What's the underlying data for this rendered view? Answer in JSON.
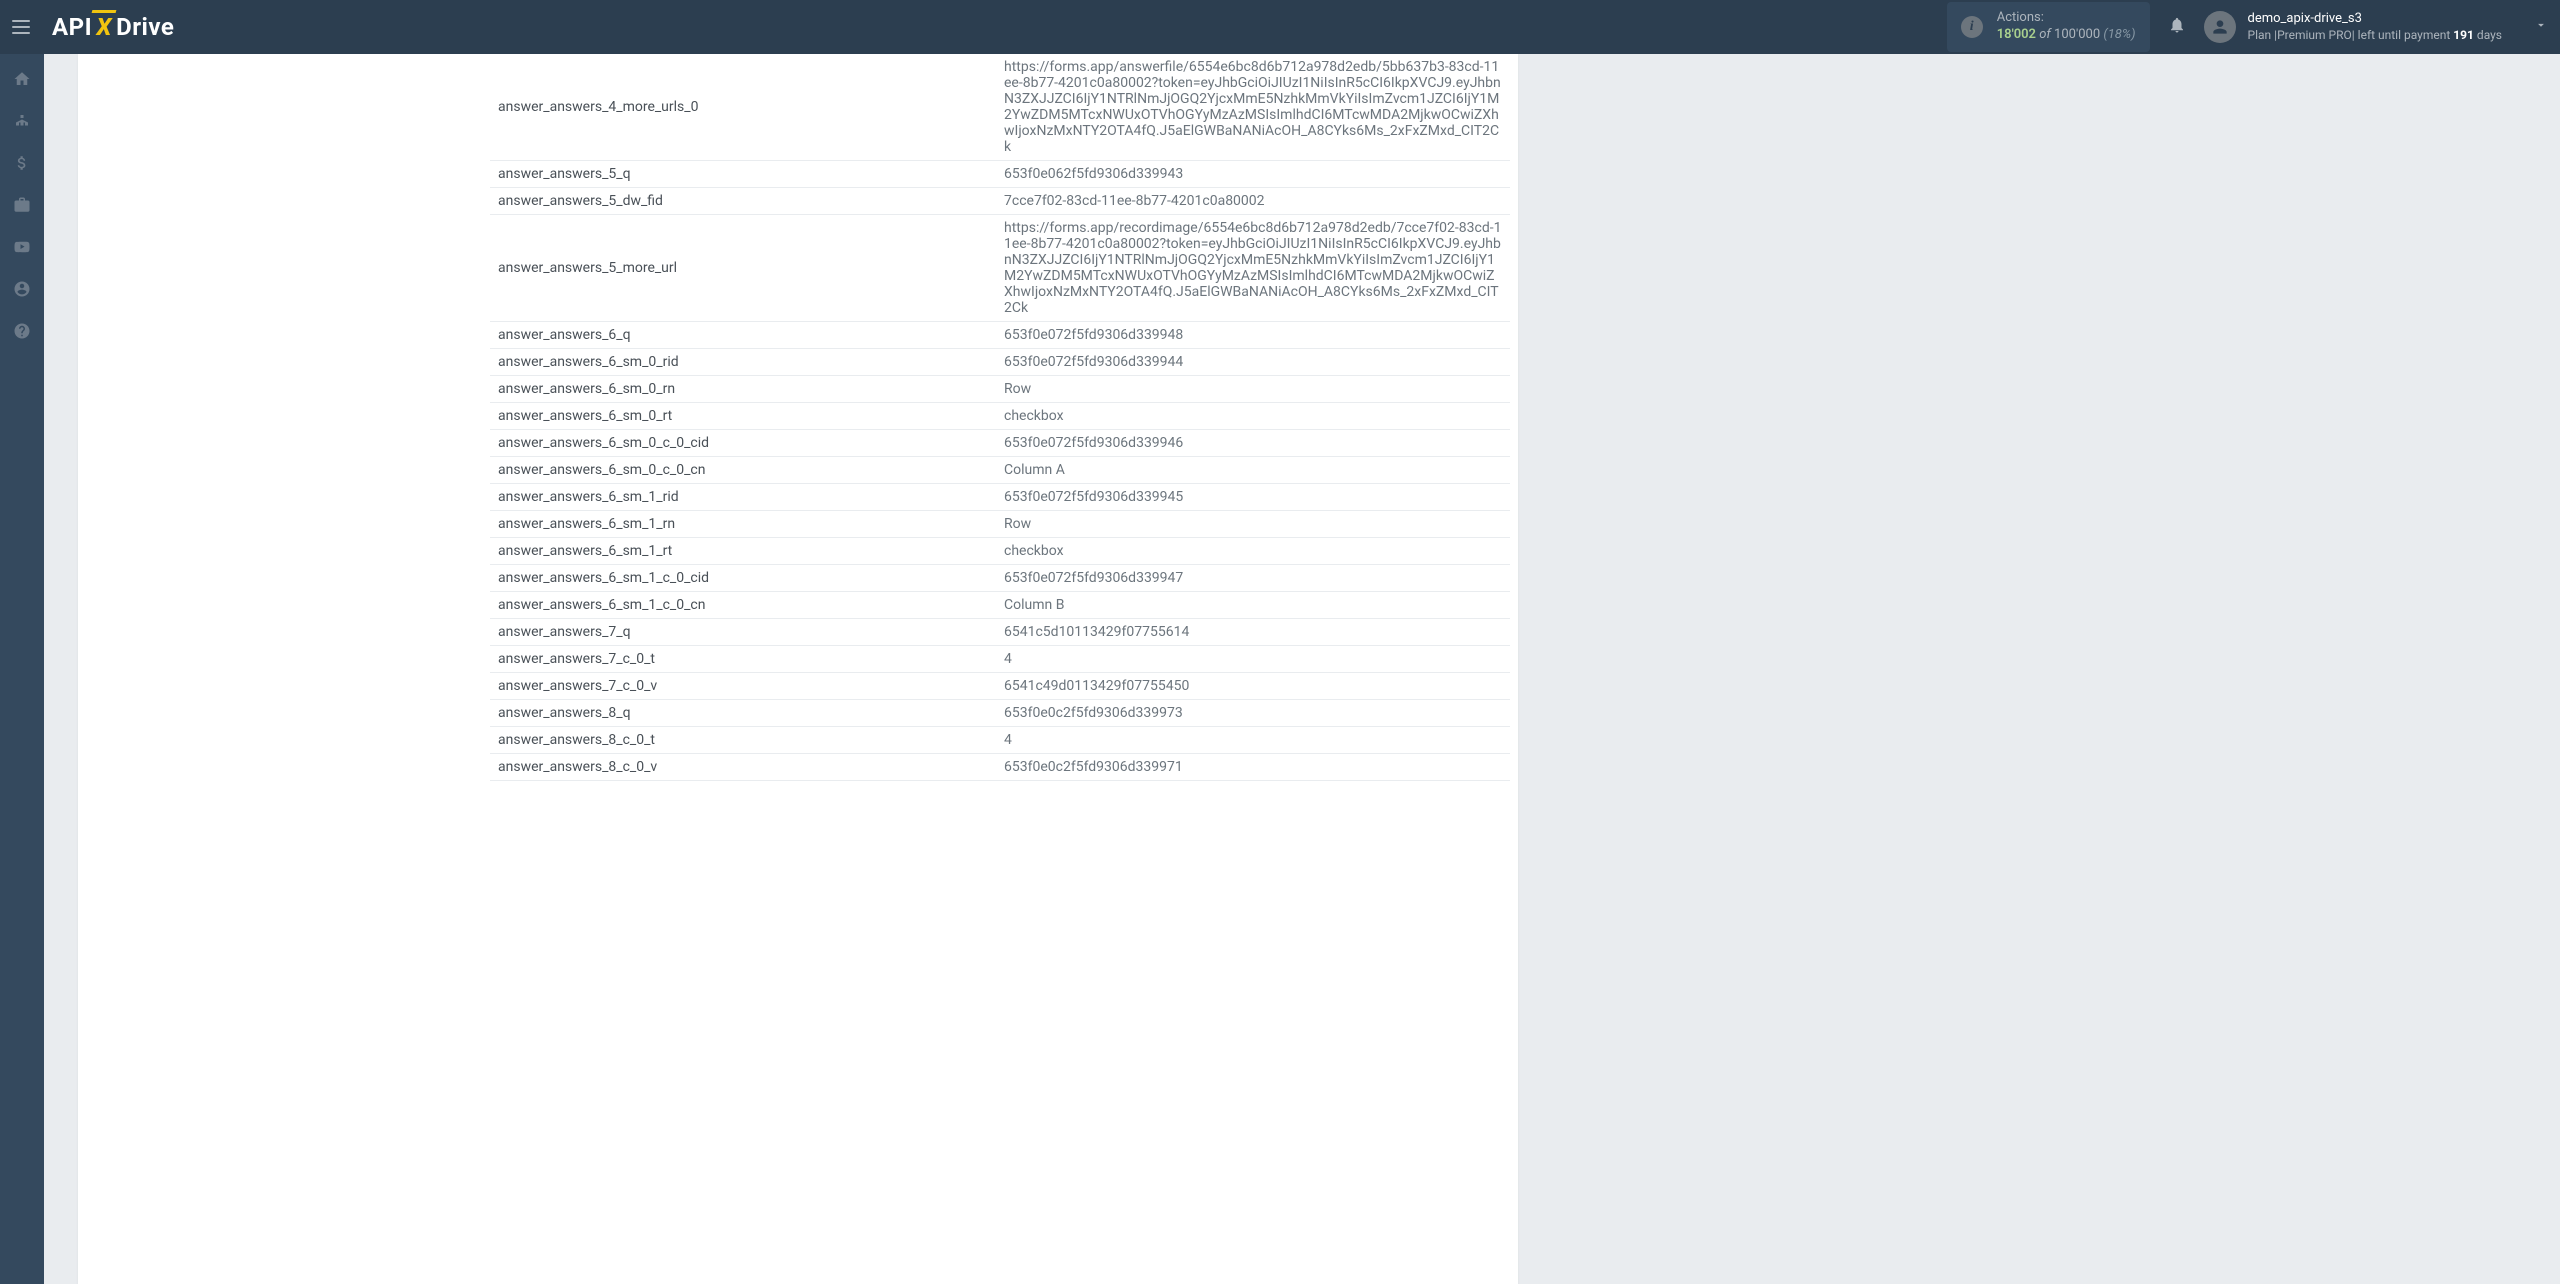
{
  "header": {
    "logo": {
      "api": "API",
      "x": "X",
      "drive": "Drive"
    },
    "actions": {
      "label": "Actions:",
      "current": "18'002",
      "of": "of",
      "total": "100'000",
      "pct": "(18%)"
    },
    "user": {
      "name": "demo_apix-drive_s3",
      "plan_prefix": "Plan |",
      "plan_name": "Premium PRO",
      "plan_suffix": "| left until payment",
      "days_num": "191",
      "days_label": "days"
    }
  },
  "rows": [
    {
      "key": "answer_answers_4_more_urls_0",
      "val": "https://forms.app/answerfile/6554e6bc8d6b712a978d2edb/5bb637b3-83cd-11ee-8b77-4201c0a80002?token=eyJhbGciOiJIUzI1NiIsInR5cCI6IkpXVCJ9.eyJhbnN3ZXJJZCI6IjY1NTRlNmJjOGQ2YjcxMmE5NzhkMmVkYiIsImZvcm1JZCI6IjY1M2YwZDM5MTcxNWUxOTVhOGYyMzAzMSIsImlhdCI6MTcwMDA2MjkwOCwiZXhwIjoxNzMxNTY2OTA4fQ.J5aElGWBaNANiAcOH_A8CYks6Ms_2xFxZMxd_CIT2Ck"
    },
    {
      "key": "answer_answers_5_q",
      "val": "653f0e062f5fd9306d339943"
    },
    {
      "key": "answer_answers_5_dw_fid",
      "val": "7cce7f02-83cd-11ee-8b77-4201c0a80002"
    },
    {
      "key": "answer_answers_5_more_url",
      "val": "https://forms.app/recordimage/6554e6bc8d6b712a978d2edb/7cce7f02-83cd-11ee-8b77-4201c0a80002?token=eyJhbGciOiJIUzI1NiIsInR5cCI6IkpXVCJ9.eyJhbnN3ZXJJZCI6IjY1NTRlNmJjOGQ2YjcxMmE5NzhkMmVkYiIsImZvcm1JZCI6IjY1M2YwZDM5MTcxNWUxOTVhOGYyMzAzMSIsImlhdCI6MTcwMDA2MjkwOCwiZXhwIjoxNzMxNTY2OTA4fQ.J5aElGWBaNANiAcOH_A8CYks6Ms_2xFxZMxd_CIT2Ck"
    },
    {
      "key": "answer_answers_6_q",
      "val": "653f0e072f5fd9306d339948"
    },
    {
      "key": "answer_answers_6_sm_0_rid",
      "val": "653f0e072f5fd9306d339944"
    },
    {
      "key": "answer_answers_6_sm_0_rn",
      "val": "Row"
    },
    {
      "key": "answer_answers_6_sm_0_rt",
      "val": "checkbox"
    },
    {
      "key": "answer_answers_6_sm_0_c_0_cid",
      "val": "653f0e072f5fd9306d339946"
    },
    {
      "key": "answer_answers_6_sm_0_c_0_cn",
      "val": "Column A"
    },
    {
      "key": "answer_answers_6_sm_1_rid",
      "val": "653f0e072f5fd9306d339945"
    },
    {
      "key": "answer_answers_6_sm_1_rn",
      "val": "Row"
    },
    {
      "key": "answer_answers_6_sm_1_rt",
      "val": "checkbox"
    },
    {
      "key": "answer_answers_6_sm_1_c_0_cid",
      "val": "653f0e072f5fd9306d339947"
    },
    {
      "key": "answer_answers_6_sm_1_c_0_cn",
      "val": "Column B"
    },
    {
      "key": "answer_answers_7_q",
      "val": "6541c5d10113429f07755614"
    },
    {
      "key": "answer_answers_7_c_0_t",
      "val": "4"
    },
    {
      "key": "answer_answers_7_c_0_v",
      "val": "6541c49d0113429f07755450"
    },
    {
      "key": "answer_answers_8_q",
      "val": "653f0e0c2f5fd9306d339973"
    },
    {
      "key": "answer_answers_8_c_0_t",
      "val": "4"
    },
    {
      "key": "answer_answers_8_c_0_v",
      "val": "653f0e0c2f5fd9306d339971"
    }
  ]
}
